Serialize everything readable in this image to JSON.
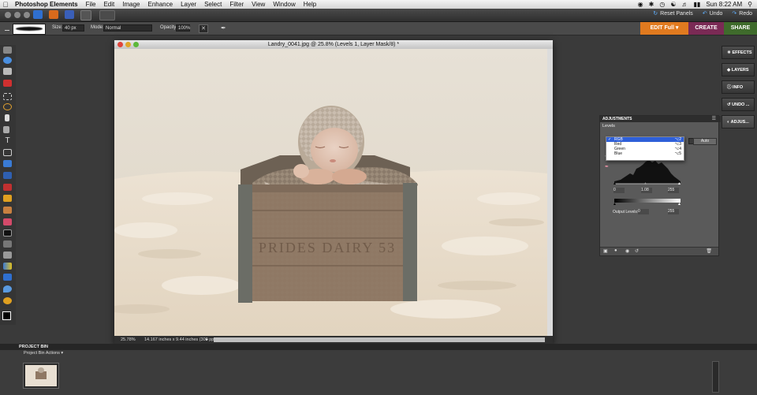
{
  "menubar": {
    "app_name": "Photoshop Elements",
    "items": [
      "File",
      "Edit",
      "Image",
      "Enhance",
      "Layer",
      "Select",
      "Filter",
      "View",
      "Window",
      "Help"
    ],
    "clock": "Sun 8:22 AM"
  },
  "appbar": {
    "reset_panels": "Reset Panels",
    "undo": "Undo",
    "redo": "Redo"
  },
  "options": {
    "size_label": "Size:",
    "size_value": "40 px",
    "mode_label": "Mode:",
    "mode_value": "Normal",
    "opacity_label": "Opacity:",
    "opacity_value": "100%",
    "edit_full": "EDIT Full",
    "create": "CREATE",
    "share": "SHARE",
    "colors": {
      "edit": "#e07a1f",
      "create": "#7a2a55",
      "share": "#3f6b2c"
    }
  },
  "document": {
    "title": "Landry_0041.jpg @ 25.8% (Levels 1, Layer Mask/8) *",
    "zoom": "25.78%",
    "doc_info": "14.167 inches x 9.44 inches (300 ppi)",
    "photo_text": "PRIDES DAIRY 53"
  },
  "right_panel": {
    "buttons": [
      "EFFECTS",
      "LAYERS",
      "INFO",
      "UNDO ...",
      "ADJUS..."
    ]
  },
  "adjustments": {
    "header": "ADJUSTMENTS",
    "subtitle": "Levels",
    "auto": "Auto",
    "channels": [
      {
        "name": "RGB",
        "shortcut": "⌥2",
        "selected": true
      },
      {
        "name": "Red",
        "shortcut": "⌥3",
        "selected": false
      },
      {
        "name": "Green",
        "shortcut": "⌥4",
        "selected": false
      },
      {
        "name": "Blue",
        "shortcut": "⌥5",
        "selected": false
      }
    ],
    "input_black": "0",
    "input_gamma": "1.08",
    "input_white": "255",
    "output_label": "Output Levels:",
    "output_black": "0",
    "output_white": "255"
  },
  "project_bin": {
    "title": "PROJECT BIN",
    "actions": "Project Bin Actions"
  }
}
